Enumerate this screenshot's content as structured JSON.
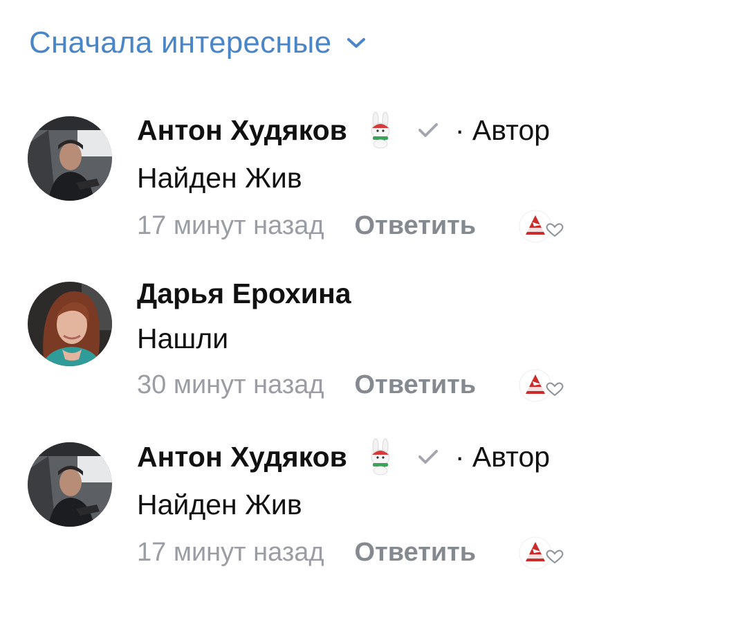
{
  "sort": {
    "label": "Сначала интересные",
    "icon": "chevron-down-icon",
    "color": "#4a86c7"
  },
  "comments": [
    {
      "author": "Антон Худяков",
      "author_tag": "· Автор",
      "is_author": true,
      "text": "Найден Жив",
      "time": "17 минут назад",
      "reply_label": "Ответить",
      "avatar": "man-in-car-avatar"
    },
    {
      "author": "Дарья Ерохина",
      "author_tag": "",
      "is_author": false,
      "text": "Нашли",
      "time": "30 минут назад",
      "reply_label": "Ответить",
      "avatar": "woman-avatar"
    },
    {
      "author": "Антон Худяков",
      "author_tag": "· Автор",
      "is_author": true,
      "text": "Найден Жив",
      "time": "17 минут назад",
      "reply_label": "Ответить",
      "avatar": "man-in-car-avatar"
    }
  ],
  "colors": {
    "link": "#4a86c7",
    "name": "#111111",
    "muted": "#9a9ea4",
    "reply": "#858a91"
  }
}
